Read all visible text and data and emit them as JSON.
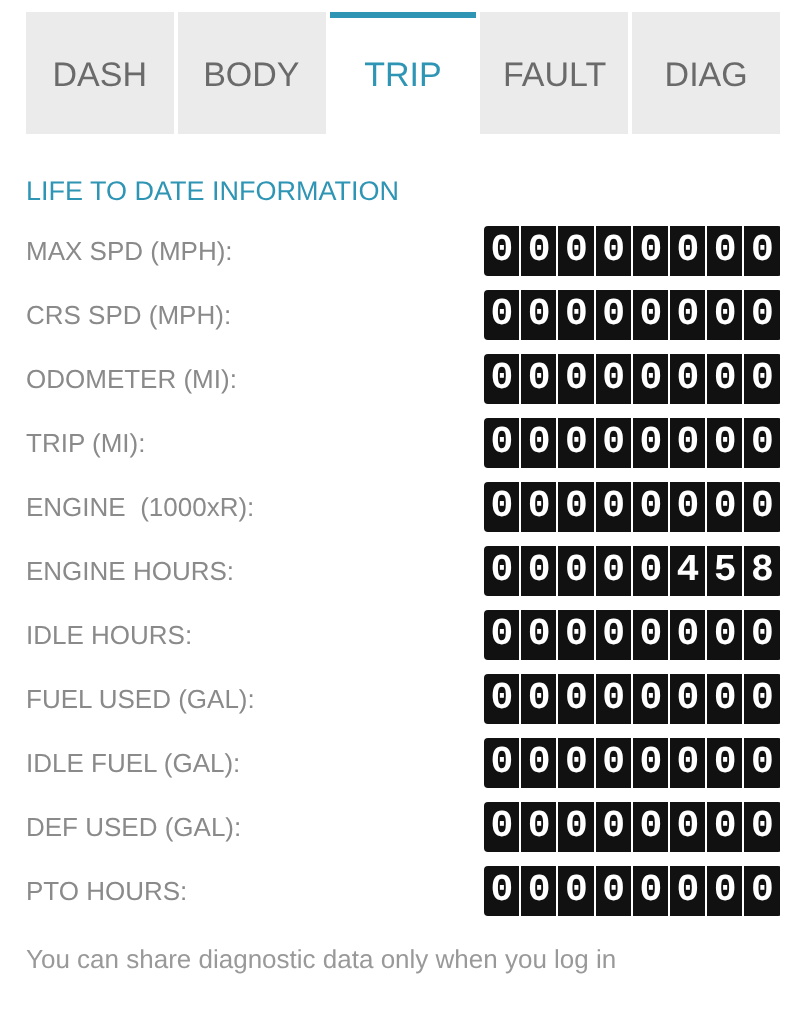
{
  "tabs": [
    {
      "label": "DASH",
      "selected": false
    },
    {
      "label": "BODY",
      "selected": false
    },
    {
      "label": "TRIP",
      "selected": true
    },
    {
      "label": "FAULT",
      "selected": false
    },
    {
      "label": "DIAG",
      "selected": false
    }
  ],
  "section_title": "LIFE TO DATE INFORMATION",
  "rows": [
    {
      "label": "MAX SPD (MPH):",
      "value": "00000000"
    },
    {
      "label": "CRS SPD (MPH):",
      "value": "00000000"
    },
    {
      "label": "ODOMETER (MI):",
      "value": "00000000"
    },
    {
      "label": "TRIP (MI):",
      "value": "00000000"
    },
    {
      "label": "ENGINE  (1000xR):",
      "value": "00000000"
    },
    {
      "label": "ENGINE HOURS:",
      "value": "00000458"
    },
    {
      "label": "IDLE HOURS:",
      "value": "00000000"
    },
    {
      "label": "FUEL USED (GAL):",
      "value": "00000000"
    },
    {
      "label": "IDLE FUEL (GAL):",
      "value": "00000000"
    },
    {
      "label": "DEF USED (GAL):",
      "value": "00000000"
    },
    {
      "label": "PTO HOURS:",
      "value": "00000000"
    }
  ],
  "footer": "You can share diagnostic data only when you log in"
}
